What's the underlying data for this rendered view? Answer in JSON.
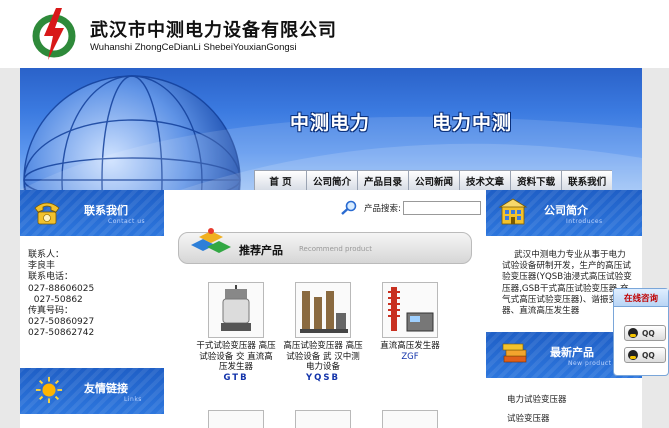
{
  "header": {
    "company_cn": "武汉市中测电力设备有限公司",
    "company_en": "Wuhanshi ZhongCeDianLi ShebeiYouxianGongsi"
  },
  "banner": {
    "slogan1": "中测电力",
    "slogan2": "电力中测"
  },
  "nav": [
    {
      "label": "首 页"
    },
    {
      "label": "公司简介"
    },
    {
      "label": "产品目录"
    },
    {
      "label": "公司新闻"
    },
    {
      "label": "技术文章"
    },
    {
      "label": "资料下载"
    },
    {
      "label": "联系我们"
    }
  ],
  "contact_section": {
    "title": "联系我们",
    "subtitle": "Contact us",
    "lines": [
      "联系人：",
      "李良丰",
      "联系电话：",
      "027-88606025",
      "  027-50862",
      "传真号码：",
      "027-50860927",
      "027-50862742"
    ]
  },
  "links_section": {
    "title": "友情链接",
    "subtitle": "Links"
  },
  "search": {
    "label": "产品搜索:",
    "placeholder": ""
  },
  "recommend": {
    "title": "推荐产品",
    "subtitle": "Recommend  product"
  },
  "products": [
    {
      "name": "干式试验变压器 高压试验设备 交 直流高压发生器",
      "code": "GTB"
    },
    {
      "name": "高压试验变压器 高压试验设备 武 汉中测电力设备",
      "code": "YQSB"
    },
    {
      "name": "直流高压发生器",
      "code": "ZGF"
    }
  ],
  "intro_section": {
    "title": "公司简介",
    "subtitle": "Introduces",
    "text": "武汉中测电力专业从事于电力试验设备研制开发，生产的高压试验变压器(YQSB油浸式高压试验变压器,GSB干式高压试验变压器,充气式高压试验变压器)、谐振变压器、直流高压发生器"
  },
  "news_section": {
    "title": "最新产品",
    "subtitle": "New product",
    "items": [
      "电力试验变压器",
      "试验变压器"
    ]
  },
  "online": {
    "title": "在线咨询",
    "buttons": [
      "QQ",
      "QQ"
    ]
  },
  "colors": {
    "banner_blue": "#3b7ae0",
    "section_blue": "#2d76dd",
    "link_code_blue": "#1233aa",
    "online_red": "#c00000"
  }
}
